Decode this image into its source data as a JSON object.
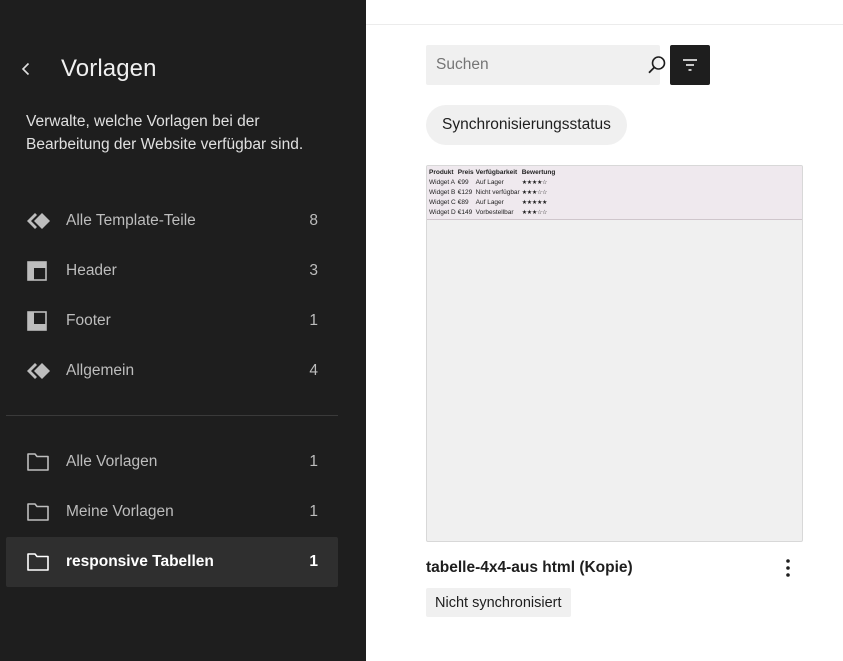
{
  "sidebar": {
    "back_icon": "chevron-left-icon",
    "title": "Vorlagen",
    "description": "Verwalte, welche Vorlagen bei der Bearbeitung der Website verfügbar sind.",
    "template_parts": [
      {
        "icon": "symbol-diamond-icon",
        "label": "Alle Template-Teile",
        "count": "8"
      },
      {
        "icon": "header-layout-icon",
        "label": "Header",
        "count": "3"
      },
      {
        "icon": "footer-layout-icon",
        "label": "Footer",
        "count": "1"
      },
      {
        "icon": "symbol-diamond-icon",
        "label": "Allgemein",
        "count": "4"
      }
    ],
    "pattern_categories": [
      {
        "icon": "folder-icon",
        "label": "Alle Vorlagen",
        "count": "1"
      },
      {
        "icon": "folder-icon",
        "label": "Meine Vorlagen",
        "count": "1"
      },
      {
        "icon": "folder-icon",
        "label": "responsive Tabellen",
        "count": "1",
        "active": true
      }
    ]
  },
  "main": {
    "search": {
      "placeholder": "Suchen",
      "value": ""
    },
    "filter_icon": "filter-icon",
    "sync_chip": "Synchronisierungsstatus",
    "card": {
      "preview": {
        "headers": [
          "Produkt",
          "Preis",
          "Verfügbarkeit",
          "Bewertung"
        ],
        "rows": [
          [
            "Widget A",
            "€99",
            "Auf Lager",
            "★★★★☆"
          ],
          [
            "Widget B",
            "€129",
            "Nicht verfügbar",
            "★★★☆☆"
          ],
          [
            "Widget C",
            "€89",
            "Auf Lager",
            "★★★★★"
          ],
          [
            "Widget D",
            "€149",
            "Vorbestellbar",
            "★★★☆☆"
          ]
        ]
      },
      "title": "tabelle-4x4-aus html (Kopie)",
      "status": "Nicht synchronisiert",
      "more_icon": "more-vertical-icon"
    }
  },
  "colors": {
    "sidebar_bg": "#1e1e1e",
    "active_item_bg": "#2f2f2f",
    "chip_bg": "#f0f0f0",
    "accent_dark": "#1e1e1e"
  }
}
